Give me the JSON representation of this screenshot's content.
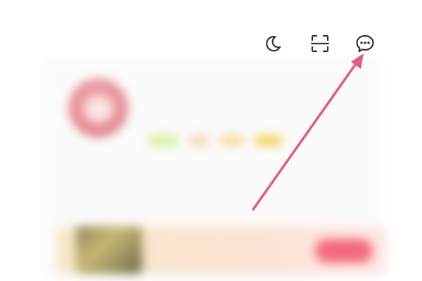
{
  "toolbar": {
    "icons": [
      "moon-icon",
      "scan-icon",
      "message-icon"
    ],
    "icon_color": "#333333"
  },
  "profile": {
    "username": "",
    "home_link": "",
    "avatar_color": "#e58a92"
  },
  "stats": [
    {
      "value": "",
      "label": ""
    },
    {
      "value": "",
      "label": ""
    },
    {
      "value": "",
      "label": ""
    },
    {
      "value": "",
      "label": ""
    }
  ],
  "banner": {
    "text": "",
    "button": ""
  },
  "annotation": {
    "arrow_color": "#e3578a"
  }
}
